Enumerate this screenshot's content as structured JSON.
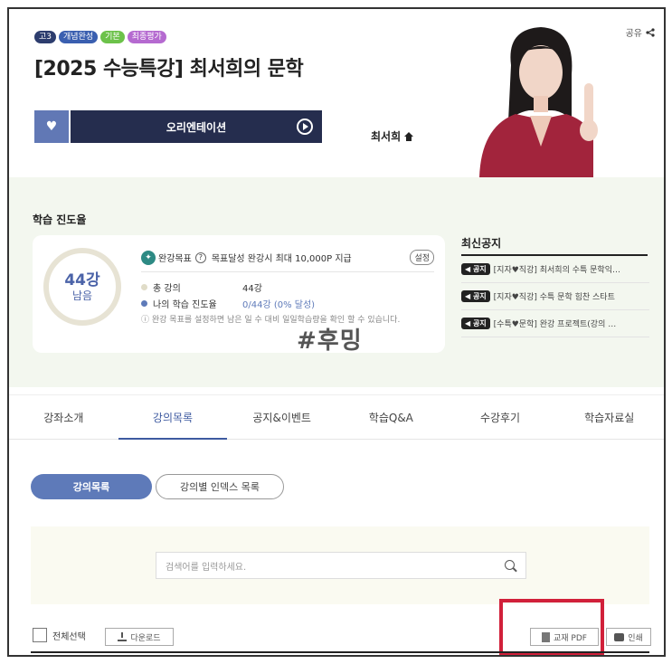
{
  "header": {
    "badges": [
      {
        "label": "고3",
        "color": "#2d3d6e"
      },
      {
        "label": "개념완성",
        "color": "#3a5fb0"
      },
      {
        "label": "기본",
        "color": "#6cc24a"
      },
      {
        "label": "최종평가",
        "color": "#b56ad0"
      }
    ],
    "title": "[2025 수능특강] 최서희의 문학",
    "share_label": "공유",
    "orientation_label": "오리엔테이션",
    "teacher_name": "최서희"
  },
  "progress": {
    "section_title": "학습 진도율",
    "remaining_count": "44강",
    "remaining_label": "남음",
    "goal_label": "완강목표",
    "goal_desc": "목표달성 완강시 최대 10,000P 지급",
    "setting_label": "설정",
    "total_label": "총 강의",
    "total_value": "44강",
    "my_label": "나의 학습 진도율",
    "my_value": "0/44강 (0% 달성)",
    "note": "완강 목표를 설정하면 남은 일 수 대비 일일학습량을 확인 할 수 있습니다."
  },
  "watermark": "#후밍",
  "notices": {
    "title": "최신공지",
    "tag": "공지",
    "items": [
      "[지자♥직강] 최서희의 수특 문학익…",
      "[지자♥직강] 수특 문학 힘찬 스타트",
      "[수특♥문학] 완강 프로젝트(강의 …"
    ]
  },
  "tabs": [
    "강좌소개",
    "강의목록",
    "공지&이벤트",
    "학습Q&A",
    "수강후기",
    "학습자료실"
  ],
  "list_tabs": {
    "active": "강의목록",
    "index": "강의별 인덱스 목록"
  },
  "search": {
    "placeholder": "검색어를 입력하세요."
  },
  "toolbar": {
    "select_all": "전체선택",
    "download": "다운로드",
    "pdf": "교재 PDF",
    "print": "인쇄"
  },
  "colors": {
    "accent": "#5e7ab9",
    "navy": "#252d4e",
    "highlight": "#d1203a"
  }
}
